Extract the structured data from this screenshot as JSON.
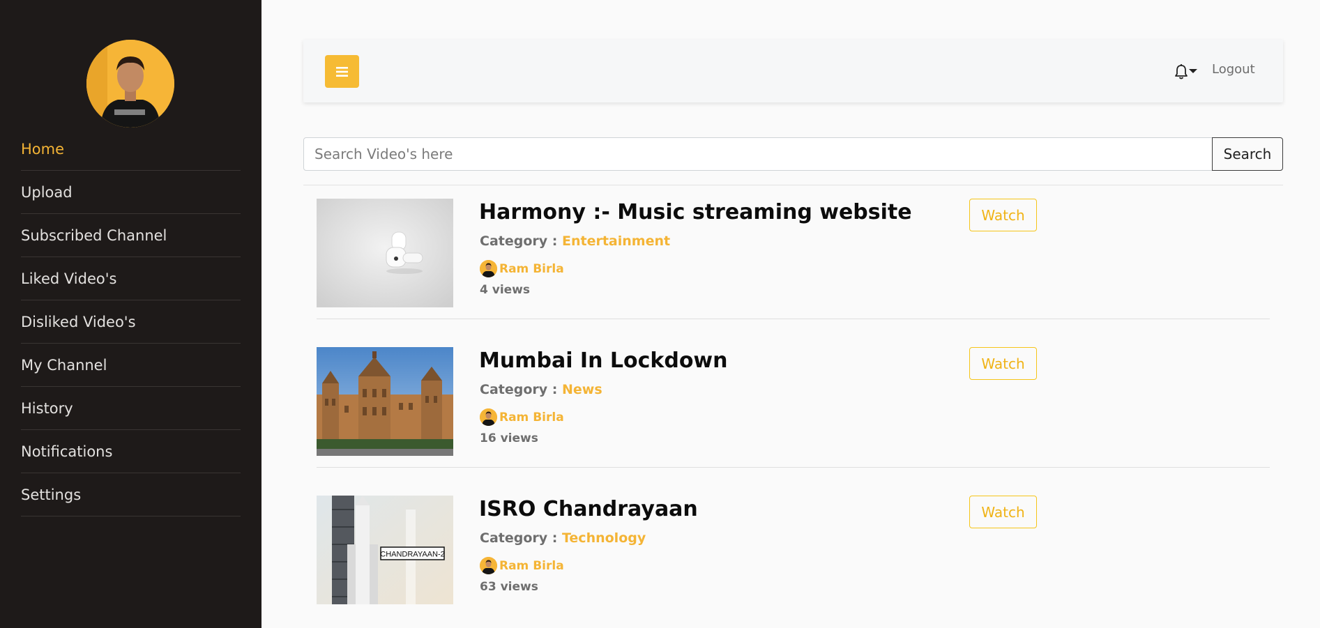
{
  "sidebar": {
    "items": [
      {
        "label": "Home",
        "active": true
      },
      {
        "label": "Upload"
      },
      {
        "label": "Subscribed Channel"
      },
      {
        "label": "Liked Video's"
      },
      {
        "label": "Disliked Video's"
      },
      {
        "label": "My Channel"
      },
      {
        "label": "History"
      },
      {
        "label": "Notifications"
      },
      {
        "label": "Settings"
      }
    ]
  },
  "header": {
    "logout_label": "Logout",
    "menu_icon": "hamburger-icon",
    "notification_icon": "bell-icon"
  },
  "search": {
    "placeholder": "Search Video's here",
    "value": "",
    "button_label": "Search"
  },
  "videos": [
    {
      "title": "Harmony :- Music streaming website",
      "category_label": "Category :",
      "category": "Entertainment",
      "author": "Ram Birla",
      "views": "4 views",
      "watch_label": "Watch"
    },
    {
      "title": "Mumbai In Lockdown",
      "category_label": "Category :",
      "category": "News",
      "author": "Ram Birla",
      "views": "16 views",
      "watch_label": "Watch"
    },
    {
      "title": "ISRO Chandrayaan",
      "category_label": "Category :",
      "category": "Technology",
      "author": "Ram Birla",
      "views": "63 views",
      "watch_label": "Watch",
      "thumbnail_text": "CHANDRAYAAN-2"
    }
  ],
  "colors": {
    "accent": "#f4b435",
    "sidebar_bg": "#1e1a19",
    "watch_border": "#f5c518"
  }
}
